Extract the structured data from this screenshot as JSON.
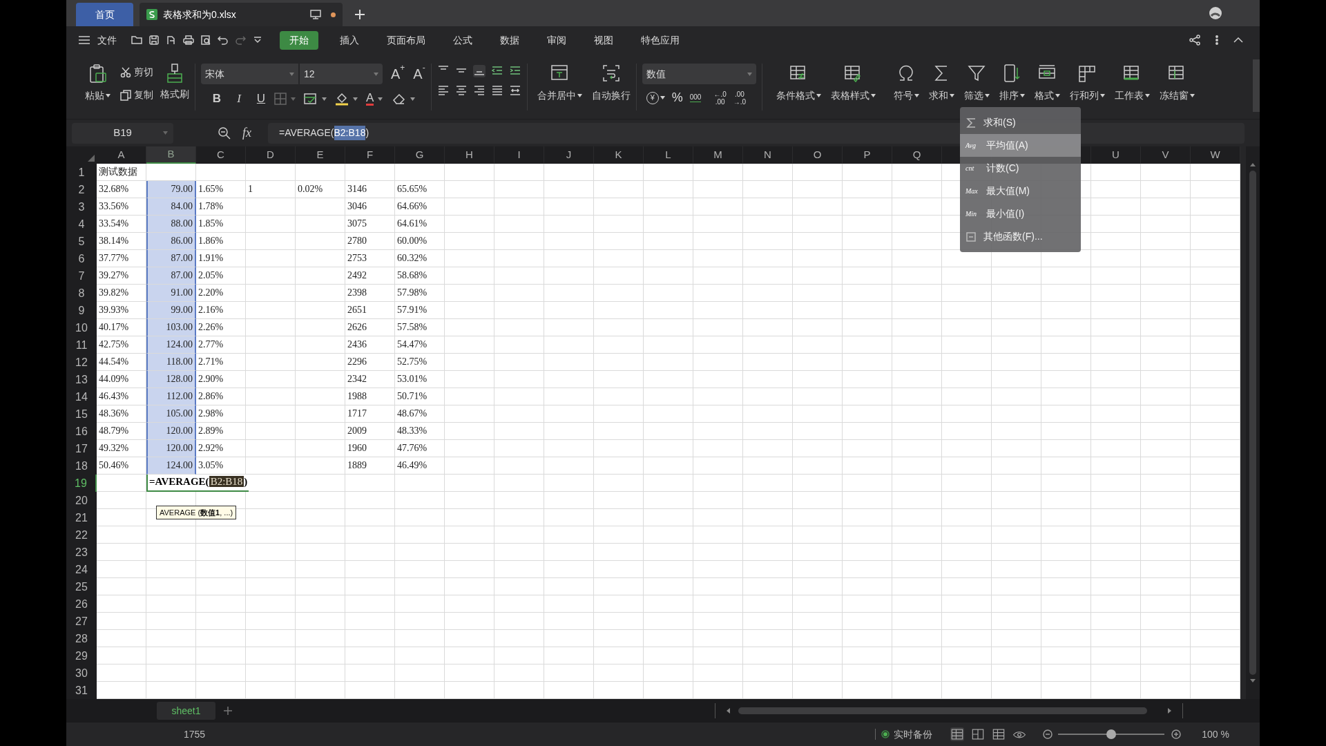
{
  "title_tabs": [
    {
      "label": "首页",
      "kind": "home",
      "selected": false
    },
    {
      "label": "表格求和为0.xlsx",
      "kind": "file",
      "selected": true,
      "unsaved": true
    }
  ],
  "menu": {
    "file": "文件",
    "tabs": [
      {
        "label": "开始",
        "selected": true
      },
      {
        "label": "插入",
        "selected": false
      },
      {
        "label": "页面布局",
        "selected": false
      },
      {
        "label": "公式",
        "selected": false
      },
      {
        "label": "数据",
        "selected": false
      },
      {
        "label": "审阅",
        "selected": false
      },
      {
        "label": "视图",
        "selected": false
      },
      {
        "label": "特色应用",
        "selected": false
      }
    ]
  },
  "toolbar": {
    "paste": "粘贴",
    "cut": "剪切",
    "copy": "复制",
    "format_painter": "格式刷",
    "font": "宋体",
    "font_size": "12",
    "size_buttons": [
      {
        "label": "A",
        "sign": "+"
      },
      {
        "label": "A",
        "sign": "-"
      }
    ],
    "style_buttons": [
      "B",
      "I",
      "U"
    ],
    "font_color": "A",
    "merge": "合并居中",
    "wrap": "自动换行",
    "number_format": "数值",
    "currency": "¥",
    "percent": "%",
    "thousands": "000",
    "decimal_buttons": [
      {
        "top": "←.0",
        "bottom": ".00"
      },
      {
        "top": ".00",
        "bottom": "→.0"
      }
    ],
    "big_buttons": [
      {
        "label": "条件格式",
        "kind": "cond"
      },
      {
        "label": "表格样式",
        "kind": "style"
      },
      {
        "label": "符号",
        "kind": "symbol"
      },
      {
        "label": "求和",
        "kind": "sum"
      },
      {
        "label": "筛选",
        "kind": "filter"
      },
      {
        "label": "排序",
        "kind": "sort"
      },
      {
        "label": "格式",
        "kind": "format"
      },
      {
        "label": "行和列",
        "kind": "rows"
      },
      {
        "label": "工作表",
        "kind": "sheet"
      },
      {
        "label": "冻结窗",
        "kind": "freeze"
      }
    ]
  },
  "formula_bar": {
    "name_box": "B19",
    "fx": "fx",
    "parts": [
      {
        "text": "=AVERAGE(",
        "highlighted": false
      },
      {
        "text": "B2:B18",
        "highlighted": true
      },
      {
        "text": ")",
        "highlighted": false
      }
    ]
  },
  "grid": {
    "columns": [
      {
        "label": "A",
        "selected": false,
        "right_aligned": false
      },
      {
        "label": "B",
        "selected": true,
        "right_aligned": true
      },
      {
        "label": "C",
        "selected": false,
        "right_aligned": false
      },
      {
        "label": "D",
        "selected": false,
        "right_aligned": false
      },
      {
        "label": "E",
        "selected": false,
        "right_aligned": false
      },
      {
        "label": "F",
        "selected": false,
        "right_aligned": false
      },
      {
        "label": "G",
        "selected": false,
        "right_aligned": false
      },
      {
        "label": "H",
        "selected": false
      },
      {
        "label": "I",
        "selected": false
      },
      {
        "label": "J",
        "selected": false
      },
      {
        "label": "K",
        "selected": false
      },
      {
        "label": "L",
        "selected": false
      },
      {
        "label": "M",
        "selected": false
      },
      {
        "label": "N",
        "selected": false
      },
      {
        "label": "O",
        "selected": false
      },
      {
        "label": "P",
        "selected": false
      },
      {
        "label": "Q",
        "selected": false
      },
      null,
      null,
      null,
      {
        "label": "U",
        "selected": false
      },
      {
        "label": "V",
        "selected": false
      },
      {
        "label": "W",
        "selected": false
      }
    ],
    "rows": [
      {
        "number": "1",
        "active": false,
        "cells": [
          {
            "text": "测试数据",
            "selected": false
          }
        ]
      },
      {
        "number": "2",
        "active": false,
        "cells": [
          {
            "text": "32.68%",
            "selected": false
          },
          {
            "text": "79.00",
            "selected": true
          },
          {
            "text": "1.65%",
            "selected": false
          },
          {
            "text": "1",
            "selected": false
          },
          {
            "text": "0.02%",
            "selected": false
          },
          {
            "text": "3146",
            "selected": false
          },
          {
            "text": "65.65%",
            "selected": false
          }
        ]
      },
      {
        "number": "3",
        "active": false,
        "cells": [
          {
            "text": "33.56%",
            "selected": false
          },
          {
            "text": "84.00",
            "selected": true
          },
          {
            "text": "1.78%",
            "selected": false
          },
          null,
          null,
          {
            "text": "3046",
            "selected": false
          },
          {
            "text": "64.66%",
            "selected": false
          }
        ]
      },
      {
        "number": "4",
        "active": false,
        "cells": [
          {
            "text": "33.54%",
            "selected": false
          },
          {
            "text": "88.00",
            "selected": true
          },
          {
            "text": "1.85%",
            "selected": false
          },
          null,
          null,
          {
            "text": "3075",
            "selected": false
          },
          {
            "text": "64.61%",
            "selected": false
          }
        ]
      },
      {
        "number": "5",
        "active": false,
        "cells": [
          {
            "text": "38.14%",
            "selected": false
          },
          {
            "text": "86.00",
            "selected": true
          },
          {
            "text": "1.86%",
            "selected": false
          },
          null,
          null,
          {
            "text": "2780",
            "selected": false
          },
          {
            "text": "60.00%",
            "selected": false
          }
        ]
      },
      {
        "number": "6",
        "active": false,
        "cells": [
          {
            "text": "37.77%",
            "selected": false
          },
          {
            "text": "87.00",
            "selected": true
          },
          {
            "text": "1.91%",
            "selected": false
          },
          null,
          null,
          {
            "text": "2753",
            "selected": false
          },
          {
            "text": "60.32%",
            "selected": false
          }
        ]
      },
      {
        "number": "7",
        "active": false,
        "cells": [
          {
            "text": "39.27%",
            "selected": false
          },
          {
            "text": "87.00",
            "selected": true
          },
          {
            "text": "2.05%",
            "selected": false
          },
          null,
          null,
          {
            "text": "2492",
            "selected": false
          },
          {
            "text": "58.68%",
            "selected": false
          }
        ]
      },
      {
        "number": "8",
        "active": false,
        "cells": [
          {
            "text": "39.82%",
            "selected": false
          },
          {
            "text": "91.00",
            "selected": true
          },
          {
            "text": "2.20%",
            "selected": false
          },
          null,
          null,
          {
            "text": "2398",
            "selected": false
          },
          {
            "text": "57.98%",
            "selected": false
          }
        ]
      },
      {
        "number": "9",
        "active": false,
        "cells": [
          {
            "text": "39.93%",
            "selected": false
          },
          {
            "text": "99.00",
            "selected": true
          },
          {
            "text": "2.16%",
            "selected": false
          },
          null,
          null,
          {
            "text": "2651",
            "selected": false
          },
          {
            "text": "57.91%",
            "selected": false
          }
        ]
      },
      {
        "number": "10",
        "active": false,
        "cells": [
          {
            "text": "40.17%",
            "selected": false
          },
          {
            "text": "103.00",
            "selected": true
          },
          {
            "text": "2.26%",
            "selected": false
          },
          null,
          null,
          {
            "text": "2626",
            "selected": false
          },
          {
            "text": "57.58%",
            "selected": false
          }
        ]
      },
      {
        "number": "11",
        "active": false,
        "cells": [
          {
            "text": "42.75%",
            "selected": false
          },
          {
            "text": "124.00",
            "selected": true
          },
          {
            "text": "2.77%",
            "selected": false
          },
          null,
          null,
          {
            "text": "2436",
            "selected": false
          },
          {
            "text": "54.47%",
            "selected": false
          }
        ]
      },
      {
        "number": "12",
        "active": false,
        "cells": [
          {
            "text": "44.54%",
            "selected": false
          },
          {
            "text": "118.00",
            "selected": true
          },
          {
            "text": "2.71%",
            "selected": false
          },
          null,
          null,
          {
            "text": "2296",
            "selected": false
          },
          {
            "text": "52.75%",
            "selected": false
          }
        ]
      },
      {
        "number": "13",
        "active": false,
        "cells": [
          {
            "text": "44.09%",
            "selected": false
          },
          {
            "text": "128.00",
            "selected": true
          },
          {
            "text": "2.90%",
            "selected": false
          },
          null,
          null,
          {
            "text": "2342",
            "selected": false
          },
          {
            "text": "53.01%",
            "selected": false
          }
        ]
      },
      {
        "number": "14",
        "active": false,
        "cells": [
          {
            "text": "46.43%",
            "selected": false
          },
          {
            "text": "112.00",
            "selected": true
          },
          {
            "text": "2.86%",
            "selected": false
          },
          null,
          null,
          {
            "text": "1988",
            "selected": false
          },
          {
            "text": "50.71%",
            "selected": false
          }
        ]
      },
      {
        "number": "15",
        "active": false,
        "cells": [
          {
            "text": "48.36%",
            "selected": false
          },
          {
            "text": "105.00",
            "selected": true
          },
          {
            "text": "2.98%",
            "selected": false
          },
          null,
          null,
          {
            "text": "1717",
            "selected": false
          },
          {
            "text": "48.67%",
            "selected": false
          }
        ]
      },
      {
        "number": "16",
        "active": false,
        "cells": [
          {
            "text": "48.79%",
            "selected": false
          },
          {
            "text": "120.00",
            "selected": true
          },
          {
            "text": "2.89%",
            "selected": false
          },
          null,
          null,
          {
            "text": "2009",
            "selected": false
          },
          {
            "text": "48.33%",
            "selected": false
          }
        ]
      },
      {
        "number": "17",
        "active": false,
        "cells": [
          {
            "text": "49.32%",
            "selected": false
          },
          {
            "text": "120.00",
            "selected": true
          },
          {
            "text": "2.92%",
            "selected": false
          },
          null,
          null,
          {
            "text": "1960",
            "selected": false
          },
          {
            "text": "47.76%",
            "selected": false
          }
        ]
      },
      {
        "number": "18",
        "active": false,
        "cells": [
          {
            "text": "50.46%",
            "selected": false
          },
          {
            "text": "124.00",
            "selected": true
          },
          {
            "text": "3.05%",
            "selected": false
          },
          null,
          null,
          {
            "text": "1889",
            "selected": false
          },
          {
            "text": "46.49%",
            "selected": false
          }
        ]
      },
      {
        "number": "19",
        "active": true,
        "cells": [
          null,
          {
            "kind": "editing",
            "selected": false,
            "parts": [
              {
                "text": "=AVERAGE(",
                "highlighted": false
              },
              {
                "text": "B2:B18",
                "highlighted": true
              },
              {
                "text": ")",
                "highlighted": false
              }
            ]
          }
        ]
      },
      {
        "number": "20",
        "active": false
      },
      {
        "number": "21",
        "active": false
      },
      {
        "number": "22",
        "active": false
      },
      {
        "number": "23",
        "active": false
      },
      {
        "number": "24",
        "active": false
      },
      {
        "number": "25",
        "active": false
      },
      {
        "number": "26",
        "active": false
      },
      {
        "number": "27",
        "active": false
      },
      {
        "number": "28",
        "active": false
      },
      {
        "number": "29",
        "active": false
      },
      {
        "number": "30",
        "active": false
      },
      {
        "number": "31",
        "active": false
      }
    ],
    "formula_hint": "AVERAGE (**数值1**, ...)"
  },
  "sum_menu": [
    {
      "kind": "sigma",
      "label": "求和(S)",
      "selected": false
    },
    {
      "kind": "text",
      "icon_text": "Avg",
      "label": "平均值(A)",
      "selected": true
    },
    {
      "kind": "text",
      "icon_text": "cnt",
      "label": "计数(C)",
      "selected": false
    },
    {
      "kind": "text",
      "icon_text": "Max",
      "label": "最大值(M)",
      "selected": false
    },
    {
      "kind": "text",
      "icon_text": "Min",
      "label": "最小值(I)",
      "selected": false
    },
    {
      "kind": "list",
      "label": "其他函数(F)...",
      "selected": false
    }
  ],
  "sheet_tabs": [
    {
      "label": "sheet1",
      "selected": true
    }
  ],
  "status_bar": {
    "value": "1755",
    "backup": "实时备份",
    "zoom": {
      "level": 0.5,
      "reading": "100 %"
    }
  }
}
